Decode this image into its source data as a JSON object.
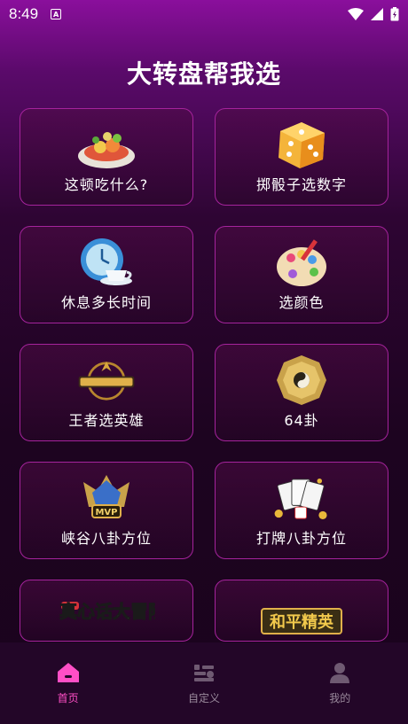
{
  "status": {
    "time": "8:49",
    "notification_icon": "A"
  },
  "title": "大转盘帮我选",
  "cards": [
    {
      "label": "这顿吃什么?",
      "icon": "food-plate-icon"
    },
    {
      "label": "掷骰子选数字",
      "icon": "dice-icon"
    },
    {
      "label": "休息多长时间",
      "icon": "clock-cup-icon"
    },
    {
      "label": "选颜色",
      "icon": "palette-icon"
    },
    {
      "label": "王者选英雄",
      "icon": "honor-of-kings-logo"
    },
    {
      "label": "64卦",
      "icon": "bagua-icon"
    },
    {
      "label": "峡谷八卦方位",
      "icon": "mvp-badge-icon"
    },
    {
      "label": "打牌八卦方位",
      "icon": "cards-dice-icon"
    },
    {
      "label": "",
      "icon": "truth-or-dare-logo",
      "logo_text": "真心话大冒险"
    },
    {
      "label": "",
      "icon": "peacekeeper-elite-logo",
      "logo_text": "和平精英"
    }
  ],
  "nav": {
    "home": "首页",
    "custom": "自定义",
    "mine": "我的"
  },
  "colors": {
    "accent": "#ff4fc6",
    "card_border": "#a5239c"
  }
}
